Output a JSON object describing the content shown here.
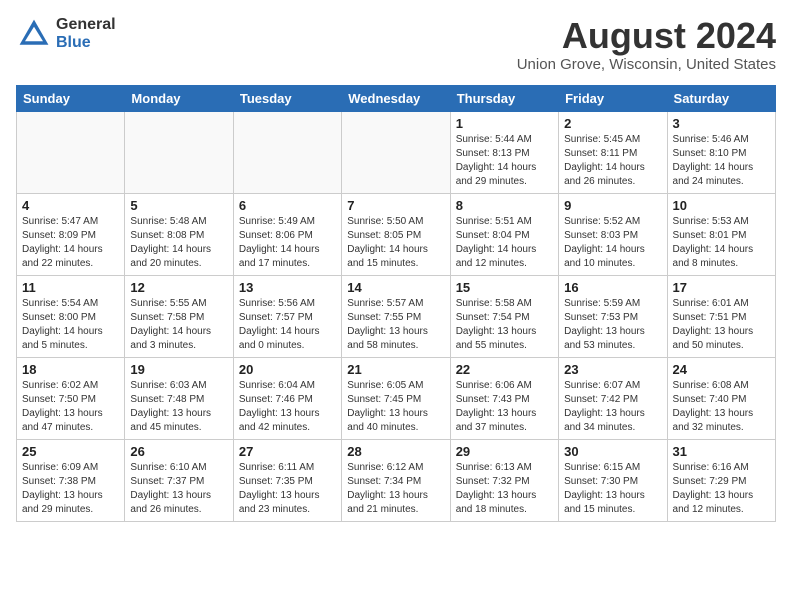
{
  "header": {
    "logo_general": "General",
    "logo_blue": "Blue",
    "month_year": "August 2024",
    "location": "Union Grove, Wisconsin, United States"
  },
  "weekdays": [
    "Sunday",
    "Monday",
    "Tuesday",
    "Wednesday",
    "Thursday",
    "Friday",
    "Saturday"
  ],
  "weeks": [
    [
      {
        "day": "",
        "info": ""
      },
      {
        "day": "",
        "info": ""
      },
      {
        "day": "",
        "info": ""
      },
      {
        "day": "",
        "info": ""
      },
      {
        "day": "1",
        "info": "Sunrise: 5:44 AM\nSunset: 8:13 PM\nDaylight: 14 hours\nand 29 minutes."
      },
      {
        "day": "2",
        "info": "Sunrise: 5:45 AM\nSunset: 8:11 PM\nDaylight: 14 hours\nand 26 minutes."
      },
      {
        "day": "3",
        "info": "Sunrise: 5:46 AM\nSunset: 8:10 PM\nDaylight: 14 hours\nand 24 minutes."
      }
    ],
    [
      {
        "day": "4",
        "info": "Sunrise: 5:47 AM\nSunset: 8:09 PM\nDaylight: 14 hours\nand 22 minutes."
      },
      {
        "day": "5",
        "info": "Sunrise: 5:48 AM\nSunset: 8:08 PM\nDaylight: 14 hours\nand 20 minutes."
      },
      {
        "day": "6",
        "info": "Sunrise: 5:49 AM\nSunset: 8:06 PM\nDaylight: 14 hours\nand 17 minutes."
      },
      {
        "day": "7",
        "info": "Sunrise: 5:50 AM\nSunset: 8:05 PM\nDaylight: 14 hours\nand 15 minutes."
      },
      {
        "day": "8",
        "info": "Sunrise: 5:51 AM\nSunset: 8:04 PM\nDaylight: 14 hours\nand 12 minutes."
      },
      {
        "day": "9",
        "info": "Sunrise: 5:52 AM\nSunset: 8:03 PM\nDaylight: 14 hours\nand 10 minutes."
      },
      {
        "day": "10",
        "info": "Sunrise: 5:53 AM\nSunset: 8:01 PM\nDaylight: 14 hours\nand 8 minutes."
      }
    ],
    [
      {
        "day": "11",
        "info": "Sunrise: 5:54 AM\nSunset: 8:00 PM\nDaylight: 14 hours\nand 5 minutes."
      },
      {
        "day": "12",
        "info": "Sunrise: 5:55 AM\nSunset: 7:58 PM\nDaylight: 14 hours\nand 3 minutes."
      },
      {
        "day": "13",
        "info": "Sunrise: 5:56 AM\nSunset: 7:57 PM\nDaylight: 14 hours\nand 0 minutes."
      },
      {
        "day": "14",
        "info": "Sunrise: 5:57 AM\nSunset: 7:55 PM\nDaylight: 13 hours\nand 58 minutes."
      },
      {
        "day": "15",
        "info": "Sunrise: 5:58 AM\nSunset: 7:54 PM\nDaylight: 13 hours\nand 55 minutes."
      },
      {
        "day": "16",
        "info": "Sunrise: 5:59 AM\nSunset: 7:53 PM\nDaylight: 13 hours\nand 53 minutes."
      },
      {
        "day": "17",
        "info": "Sunrise: 6:01 AM\nSunset: 7:51 PM\nDaylight: 13 hours\nand 50 minutes."
      }
    ],
    [
      {
        "day": "18",
        "info": "Sunrise: 6:02 AM\nSunset: 7:50 PM\nDaylight: 13 hours\nand 47 minutes."
      },
      {
        "day": "19",
        "info": "Sunrise: 6:03 AM\nSunset: 7:48 PM\nDaylight: 13 hours\nand 45 minutes."
      },
      {
        "day": "20",
        "info": "Sunrise: 6:04 AM\nSunset: 7:46 PM\nDaylight: 13 hours\nand 42 minutes."
      },
      {
        "day": "21",
        "info": "Sunrise: 6:05 AM\nSunset: 7:45 PM\nDaylight: 13 hours\nand 40 minutes."
      },
      {
        "day": "22",
        "info": "Sunrise: 6:06 AM\nSunset: 7:43 PM\nDaylight: 13 hours\nand 37 minutes."
      },
      {
        "day": "23",
        "info": "Sunrise: 6:07 AM\nSunset: 7:42 PM\nDaylight: 13 hours\nand 34 minutes."
      },
      {
        "day": "24",
        "info": "Sunrise: 6:08 AM\nSunset: 7:40 PM\nDaylight: 13 hours\nand 32 minutes."
      }
    ],
    [
      {
        "day": "25",
        "info": "Sunrise: 6:09 AM\nSunset: 7:38 PM\nDaylight: 13 hours\nand 29 minutes."
      },
      {
        "day": "26",
        "info": "Sunrise: 6:10 AM\nSunset: 7:37 PM\nDaylight: 13 hours\nand 26 minutes."
      },
      {
        "day": "27",
        "info": "Sunrise: 6:11 AM\nSunset: 7:35 PM\nDaylight: 13 hours\nand 23 minutes."
      },
      {
        "day": "28",
        "info": "Sunrise: 6:12 AM\nSunset: 7:34 PM\nDaylight: 13 hours\nand 21 minutes."
      },
      {
        "day": "29",
        "info": "Sunrise: 6:13 AM\nSunset: 7:32 PM\nDaylight: 13 hours\nand 18 minutes."
      },
      {
        "day": "30",
        "info": "Sunrise: 6:15 AM\nSunset: 7:30 PM\nDaylight: 13 hours\nand 15 minutes."
      },
      {
        "day": "31",
        "info": "Sunrise: 6:16 AM\nSunset: 7:29 PM\nDaylight: 13 hours\nand 12 minutes."
      }
    ]
  ]
}
